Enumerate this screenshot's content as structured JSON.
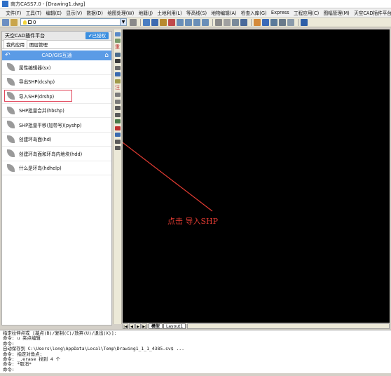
{
  "window": {
    "title": "南方CASS7.0 - [Drawing1.dwg]"
  },
  "menu": {
    "items": [
      "文件(F)",
      "工具(T)",
      "编辑(E)",
      "显示(V)",
      "数据(D)",
      "绘图处理(W)",
      "地籍(J)",
      "土地利用(L)",
      "等高线(S)",
      "地物编辑(A)",
      "检查入库(G)",
      "Express",
      "工程应用(C)",
      "图幅管理(M)",
      "天空CAD插件平台"
    ]
  },
  "toolbar": {
    "layer_value": "0"
  },
  "panel": {
    "title": "天空CAD插件平台",
    "auth_status": "已授权",
    "tabs": [
      {
        "label": "我的应用",
        "active": true
      },
      {
        "label": "图层管理",
        "active": false
      }
    ],
    "section_title": "CAD/GIS互通",
    "items": [
      {
        "label": "属性编辑器(sx)"
      },
      {
        "label": "导出SHP(dcshp)"
      },
      {
        "label": "导入SHP(drshp)",
        "highlighted": true
      },
      {
        "label": "SHP批量合并(hbshp)"
      },
      {
        "label": "SHP批量平移(加带号)(pyshp)"
      },
      {
        "label": "创建环岛面(hd)"
      },
      {
        "label": "创建环岛面和环岛内地块(hdd)"
      },
      {
        "label": "什么是环岛(hdhelp)"
      }
    ]
  },
  "vtoolbar": {
    "labels": [
      "重",
      "注"
    ]
  },
  "canvas": {
    "annotation": "点击  导入SHP"
  },
  "layout_tabs": {
    "model": "模型",
    "layout1": "Layout1"
  },
  "command_history": [
    "指定拉伸点或 [基点(B)/复制(C)/放弃(U)/退出(X)]:",
    "命令: u 夹点编辑",
    "命令:",
    "自动保存到 C:\\Users\\long\\AppData\\Local\\Temp\\Drawing1_1_1_4385.sv$ ...",
    "命令: 指定对角点:",
    "命令: _.erase 找到 4 个",
    "命令: *取消*",
    "命令:"
  ],
  "colors": {
    "highlight_border": "#e2465b",
    "annotation_red": "#e23b32",
    "section_blue": "#5b9be6",
    "auth_blue": "#3c8fe0"
  }
}
